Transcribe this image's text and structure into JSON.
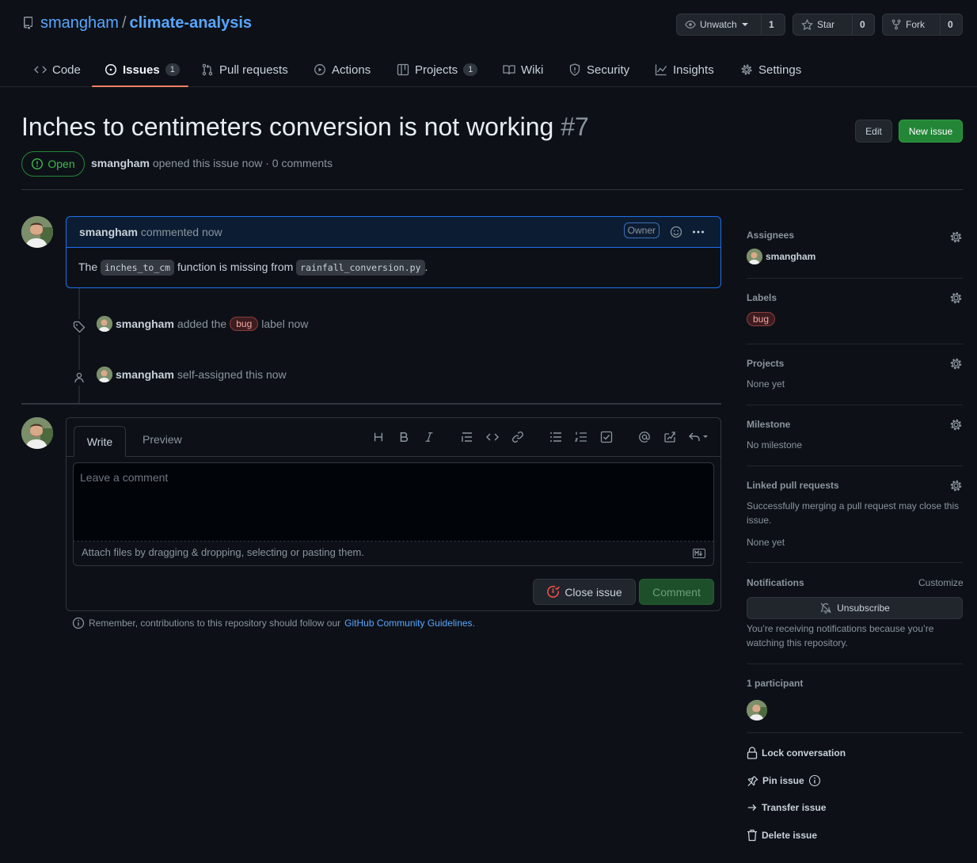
{
  "repo": {
    "owner": "smangham",
    "separator": "/",
    "name": "climate-analysis"
  },
  "header_buttons": {
    "watch": {
      "label": "Unwatch",
      "count": "1"
    },
    "star": {
      "label": "Star",
      "count": "0"
    },
    "fork": {
      "label": "Fork",
      "count": "0"
    }
  },
  "tabs": [
    {
      "label": "Code",
      "icon": "code-icon"
    },
    {
      "label": "Issues",
      "icon": "issue-icon",
      "count": "1",
      "active": true
    },
    {
      "label": "Pull requests",
      "icon": "pull-request-icon"
    },
    {
      "label": "Actions",
      "icon": "play-icon"
    },
    {
      "label": "Projects",
      "icon": "table-icon",
      "count": "1"
    },
    {
      "label": "Wiki",
      "icon": "book-icon"
    },
    {
      "label": "Security",
      "icon": "shield-icon"
    },
    {
      "label": "Insights",
      "icon": "graph-icon"
    },
    {
      "label": "Settings",
      "icon": "gear-icon"
    }
  ],
  "issue": {
    "title": "Inches to centimeters conversion is not working",
    "number": "#7",
    "state": "Open",
    "author": "smangham",
    "meta_text": "opened this issue now · 0 comments",
    "edit_label": "Edit",
    "new_issue_label": "New issue"
  },
  "comment": {
    "author": "smangham",
    "time_text": "commented now",
    "role": "Owner",
    "body_prefix": "The",
    "code1": "inches_to_cm",
    "body_mid": "function is missing from",
    "code2": "rainfall_conversion.py",
    "body_suffix": "."
  },
  "events": [
    {
      "author": "smangham",
      "pre": "added the",
      "label": "bug",
      "post": "label now"
    },
    {
      "author": "smangham",
      "text": "self-assigned this now"
    }
  ],
  "editor": {
    "tab_write": "Write",
    "tab_preview": "Preview",
    "placeholder": "Leave a comment",
    "attach_text": "Attach files by dragging & dropping, selecting or pasting them.",
    "close_label": "Close issue",
    "comment_label": "Comment"
  },
  "remember": {
    "text": "Remember, contributions to this repository should follow our",
    "link": "GitHub Community Guidelines",
    "suffix": "."
  },
  "sidebar": {
    "assignees_title": "Assignees",
    "assignee": "smangham",
    "labels_title": "Labels",
    "label": "bug",
    "projects_title": "Projects",
    "projects_value": "None yet",
    "milestone_title": "Milestone",
    "milestone_value": "No milestone",
    "linked_title": "Linked pull requests",
    "linked_desc": "Successfully merging a pull request may close this issue.",
    "linked_value": "None yet",
    "notifications_title": "Notifications",
    "customize": "Customize",
    "unsubscribe": "Unsubscribe",
    "notif_desc": "You’re receiving notifications because you’re watching this repository.",
    "participants_title": "1 participant",
    "lock": "Lock conversation",
    "pin": "Pin issue",
    "transfer": "Transfer issue",
    "delete": "Delete issue"
  },
  "colors": {
    "accent": "#58a6ff",
    "open_green": "#3fb950",
    "primary_button": "#238636",
    "tab_underline": "#f78166",
    "bug_label": "#f6a7a4"
  }
}
